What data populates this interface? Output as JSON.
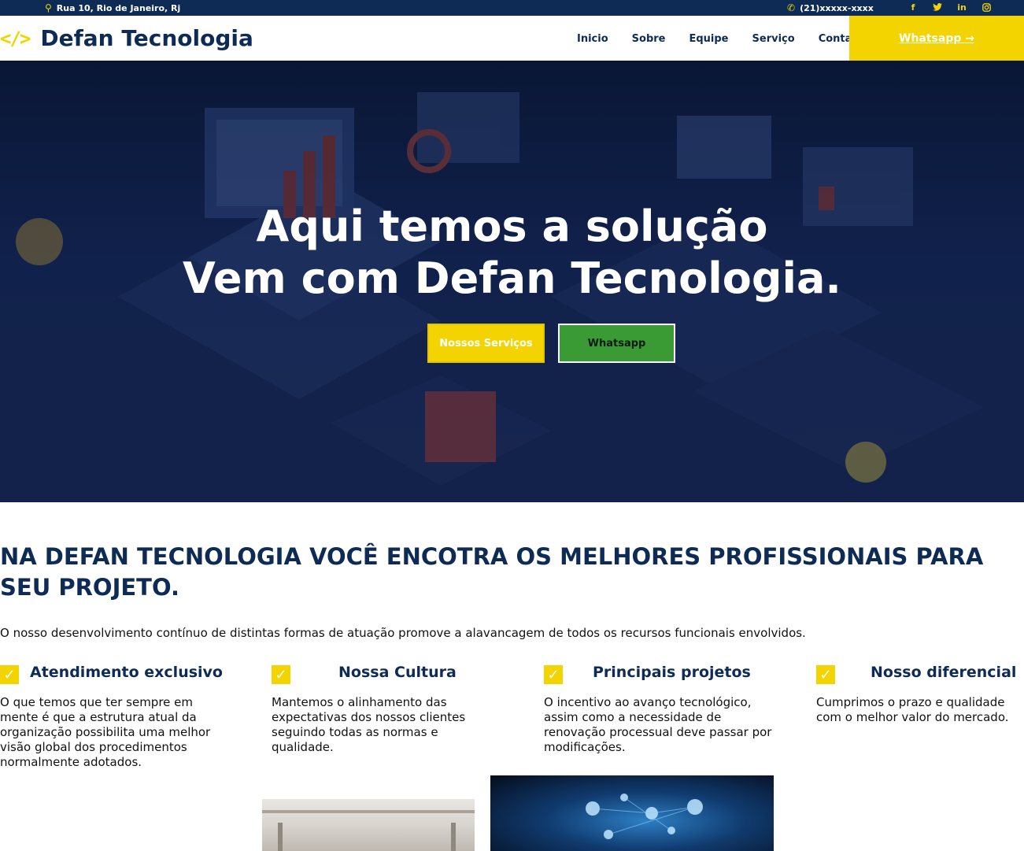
{
  "topbar": {
    "address": "Rua 10, Rio de Janeiro, Rj",
    "address_icon": "map-pin-icon",
    "phone": "(21)xxxxx-xxxx",
    "phone_icon": "phone-icon",
    "social": [
      "facebook-icon",
      "twitter-icon",
      "linkedin-icon",
      "instagram-icon"
    ]
  },
  "header": {
    "logo_mark": "</>",
    "logo_text": "Defan Tecnologia",
    "nav": [
      "Inicio",
      "Sobre",
      "Equipe",
      "Serviço",
      "Contato"
    ],
    "cta": "Whatsapp →"
  },
  "hero": {
    "line1": "Aqui temos a solução",
    "line2": "Vem com Defan Tecnologia.",
    "btn_services": "Nossos Serviços",
    "btn_whatsapp": "Whatsapp"
  },
  "main": {
    "headline": "NA DEFAN TECNOLOGIA VOCÊ ENCOTRA OS MELHORES PROFISSIONAIS PARA SEU PROJETO.",
    "intro": "O nosso desenvolvimento contínuo de distintas formas de atuação promove a alavancagem de todos os recursos funcionais envolvidos.",
    "features": [
      {
        "title": "Atendimento exclusivo",
        "text": "O que temos que ter sempre em mente é que a estrutura atual da organização possibilita uma melhor visão global dos procedimentos normalmente adotados."
      },
      {
        "title": "Nossa Cultura",
        "text": "Mantemos o alinhamento das expectativas dos nossos clientes seguindo todas as normas e qualidade."
      },
      {
        "title": "Principais projetos",
        "text": "O incentivo ao avanço tecnológico, assim como a necessidade de renovação processual deve passar por modificações."
      },
      {
        "title": "Nosso diferencial",
        "text": "Cumprimos o prazo e qualidade com o melhor valor do mercado."
      }
    ]
  },
  "colors": {
    "navy": "#0d2b55",
    "yellow": "#f3d300",
    "green": "#3a9b35"
  }
}
